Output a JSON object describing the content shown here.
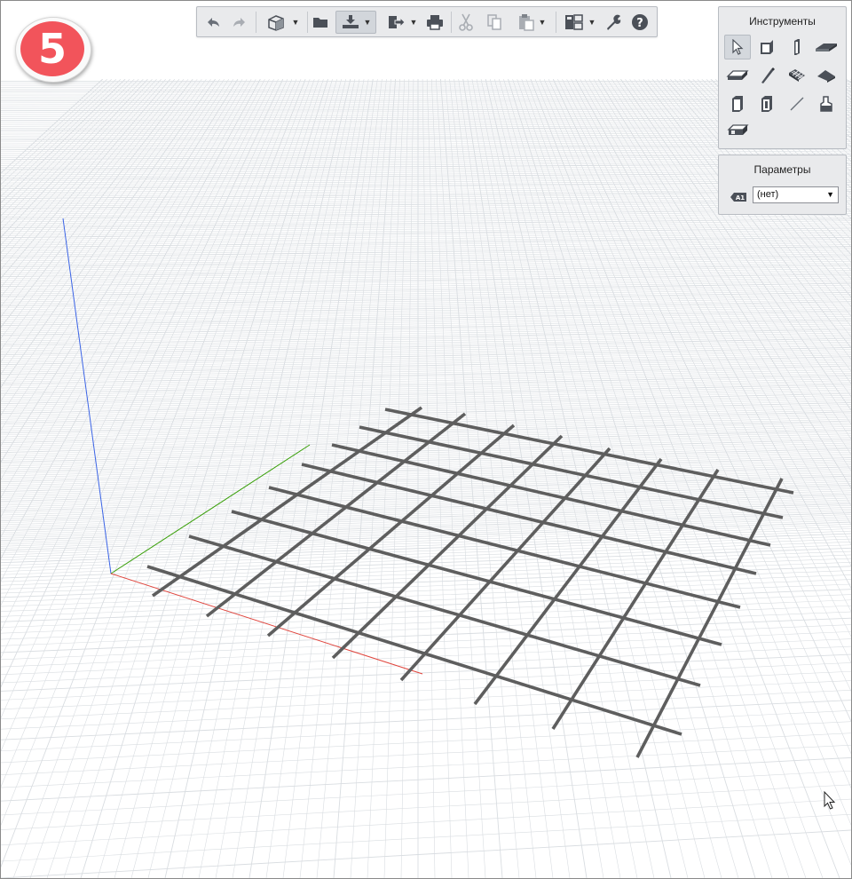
{
  "step": {
    "number": "5",
    "color": "#f2545b"
  },
  "toolbar": {
    "items": [
      {
        "name": "undo-icon"
      },
      {
        "name": "redo-icon"
      },
      {
        "name": "view-3d-icon",
        "dropdown": true
      },
      {
        "name": "open-folder-icon"
      },
      {
        "name": "import-icon",
        "dropdown": true,
        "active": true
      },
      {
        "name": "export-icon",
        "dropdown": true
      },
      {
        "name": "print-icon"
      },
      {
        "name": "cut-icon"
      },
      {
        "name": "copy-icon"
      },
      {
        "name": "paste-icon",
        "dropdown": true
      },
      {
        "name": "views-icon",
        "dropdown": true
      },
      {
        "name": "settings-wrench-icon"
      },
      {
        "name": "help-icon"
      }
    ]
  },
  "tools_panel": {
    "title": "Инструменты",
    "tools": [
      {
        "name": "select-arrow-icon",
        "active": true
      },
      {
        "name": "wall-icon"
      },
      {
        "name": "column-icon"
      },
      {
        "name": "slab-icon"
      },
      {
        "name": "beam-icon"
      },
      {
        "name": "rebar-icon"
      },
      {
        "name": "mesh-icon"
      },
      {
        "name": "roof-icon"
      },
      {
        "name": "door-icon"
      },
      {
        "name": "window-icon"
      },
      {
        "name": "line-icon"
      },
      {
        "name": "object-icon"
      },
      {
        "name": "opening-icon"
      }
    ]
  },
  "params_panel": {
    "title": "Параметры",
    "layer_tag": "A1",
    "layer_value": "(нет)"
  },
  "scene": {
    "axis_colors": {
      "x": "#e0443c",
      "y": "#3aa00a",
      "z": "#3b64e6"
    },
    "mesh_color": "#5e5e5e",
    "grid_color": "#d9dde1"
  }
}
